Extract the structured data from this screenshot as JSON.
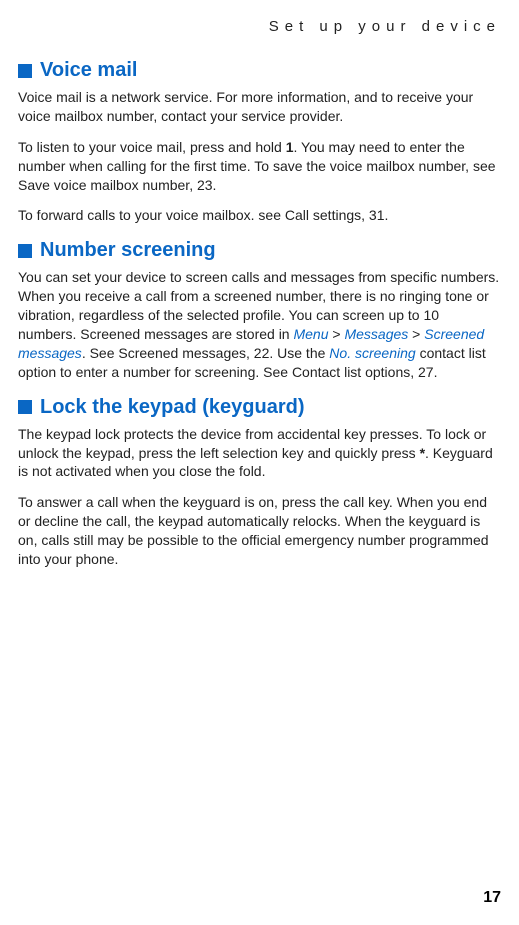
{
  "header": "Set up your device",
  "sections": [
    {
      "title": "Voice mail",
      "paras": [
        {
          "segments": [
            {
              "text": "Voice mail is a network service. For more information, and to receive your voice mailbox number, contact your service provider."
            }
          ]
        },
        {
          "segments": [
            {
              "text": "To listen to your voice mail, press and hold "
            },
            {
              "text": "1",
              "bold": true
            },
            {
              "text": ". You may need to enter the number when calling for the first time. To save the voice mailbox number, see Save voice mailbox number, 23."
            }
          ]
        },
        {
          "segments": [
            {
              "text": "To forward calls to your voice mailbox. see Call settings, 31."
            }
          ]
        }
      ]
    },
    {
      "title": "Number screening",
      "paras": [
        {
          "segments": [
            {
              "text": "You can set your device to screen calls and messages from specific numbers. When you receive a call from a screened number, there is no ringing tone or vibration, regardless of the selected profile. You can screen up to 10 numbers. Screened messages are stored in "
            },
            {
              "text": "Menu",
              "link": true
            },
            {
              "text": " > "
            },
            {
              "text": "Messages",
              "link": true
            },
            {
              "text": " > "
            },
            {
              "text": "Screened messages",
              "link": true
            },
            {
              "text": ". See Screened messages, 22. Use the "
            },
            {
              "text": "No. screening",
              "link": true
            },
            {
              "text": " contact list option to enter a number for screening. See Contact list options, 27."
            }
          ]
        }
      ]
    },
    {
      "title": "Lock the keypad (keyguard)",
      "paras": [
        {
          "segments": [
            {
              "text": "The keypad lock protects the device from accidental key presses. To lock or unlock the keypad, press the left selection key and quickly press "
            },
            {
              "text": "*",
              "bold": true
            },
            {
              "text": ". Keyguard is not activated when you close the fold."
            }
          ]
        },
        {
          "segments": [
            {
              "text": "To answer a call when the keyguard is on, press the call key. When you end or decline the call, the keypad automatically relocks. When the keyguard is on, calls still may be possible to the official emergency number programmed into your phone."
            }
          ]
        }
      ]
    }
  ],
  "pageNumber": "17"
}
